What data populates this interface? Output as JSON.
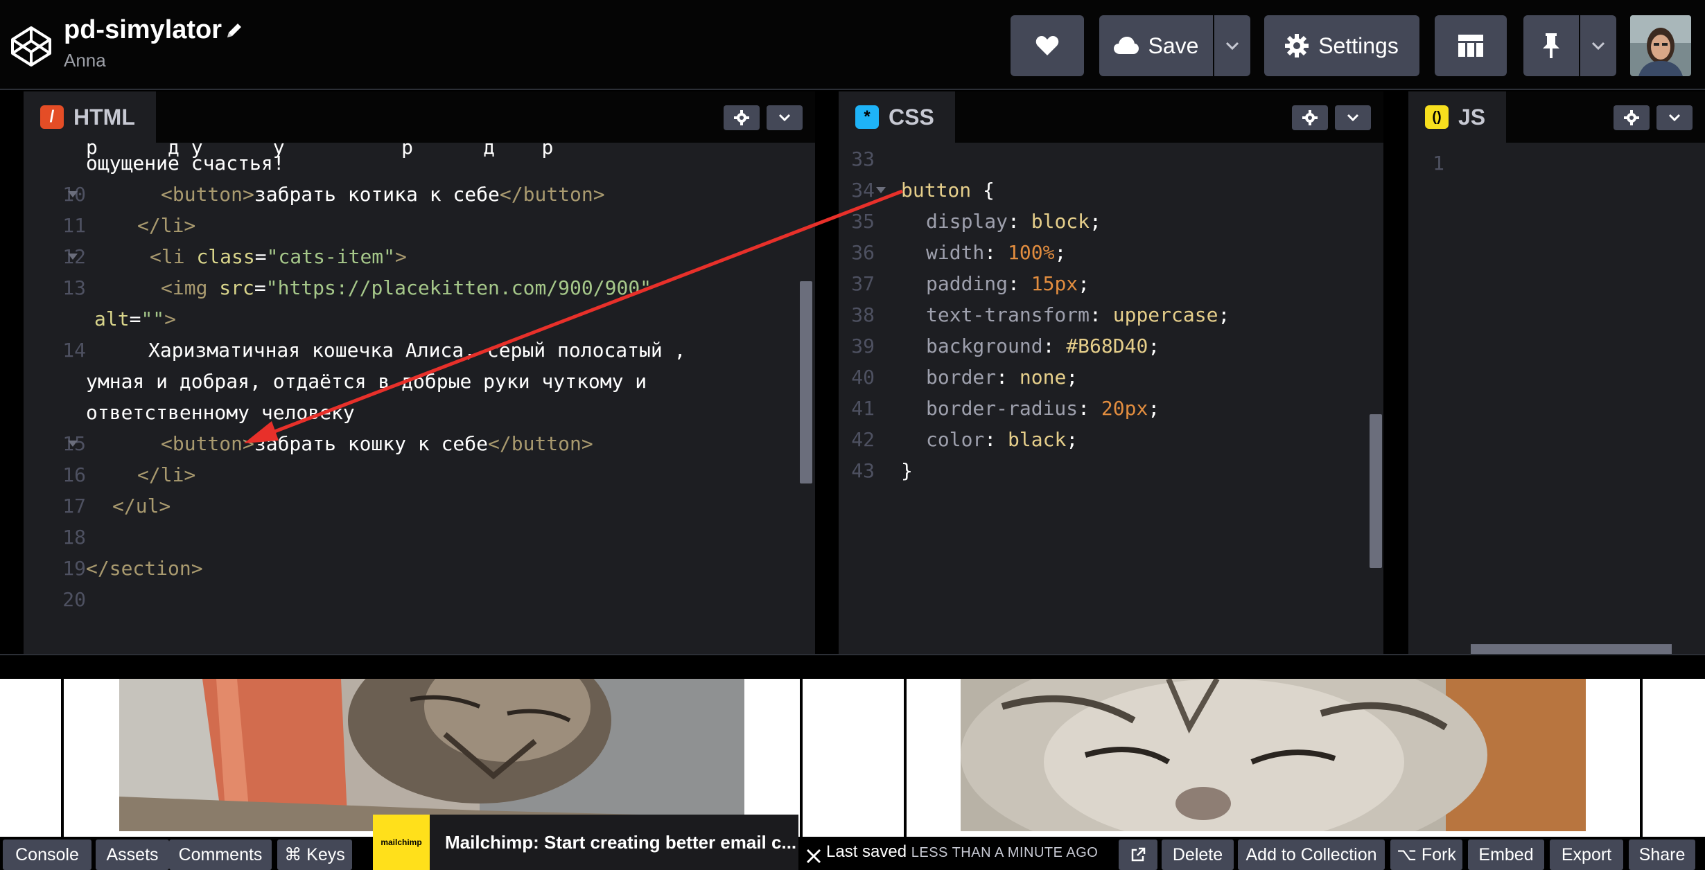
{
  "header": {
    "title": "pd-simylator",
    "author": "Anna",
    "save_label": "Save",
    "settings_label": "Settings"
  },
  "panels": {
    "html": {
      "label": "HTML",
      "lines": [
        {
          "num": "",
          "text": "ощущение счастья!"
        },
        {
          "num": "10",
          "text": "<button>забрать котика к себе</button>"
        },
        {
          "num": "11",
          "text": "</li>"
        },
        {
          "num": "12",
          "text": "<li class=\"cats-item\">"
        },
        {
          "num": "13",
          "text": "<img src=\"https://placekitten.com/900/900\""
        },
        {
          "num": "",
          "text": "alt=\"\">"
        },
        {
          "num": "14",
          "text": "Харизматичная кошечка Алиса, серый полосатый ,"
        },
        {
          "num": "",
          "text": "умная и добрая, отдаётся в добрые руки чуткому и"
        },
        {
          "num": "",
          "text": "ответственному человеку"
        },
        {
          "num": "15",
          "text": "<button>забрать кошку к себе</button>"
        },
        {
          "num": "16",
          "text": "</li>"
        },
        {
          "num": "17",
          "text": "</ul>"
        },
        {
          "num": "18",
          "text": ""
        },
        {
          "num": "19",
          "text": "</section>"
        },
        {
          "num": "20",
          "text": ""
        }
      ]
    },
    "css": {
      "label": "CSS",
      "lines": [
        {
          "num": "33",
          "text": ""
        },
        {
          "num": "34",
          "text": "button {"
        },
        {
          "num": "35",
          "text": "display: block;"
        },
        {
          "num": "36",
          "text": "width: 100%;"
        },
        {
          "num": "37",
          "text": "padding: 15px;"
        },
        {
          "num": "38",
          "text": "text-transform: uppercase;"
        },
        {
          "num": "39",
          "text": "background: #B68D40;"
        },
        {
          "num": "40",
          "text": "border: none;"
        },
        {
          "num": "41",
          "text": "border-radius: 20px;"
        },
        {
          "num": "42",
          "text": "color: black;"
        },
        {
          "num": "43",
          "text": "}"
        }
      ]
    },
    "js": {
      "label": "JS",
      "lines": [
        {
          "num": "1",
          "text": ""
        }
      ]
    }
  },
  "ad": {
    "logo_text": "mailchimp",
    "text": "Mailchimp: Start creating better email c..."
  },
  "status": {
    "saved_prefix": "Last saved",
    "saved_time": "LESS THAN A MINUTE AGO"
  },
  "footer": {
    "console": "Console",
    "assets": "Assets",
    "comments": "Comments",
    "keys": "⌘ Keys",
    "delete": "Delete",
    "add_to_collection": "Add to Collection",
    "fork": "⌥ Fork",
    "embed": "Embed",
    "export": "Export",
    "share": "Share"
  },
  "colors": {
    "accent_html": "#e44d26",
    "accent_css": "#1eb3f7",
    "accent_js": "#f7df1e",
    "arrow": "#e8302a",
    "button_bg": "#444857"
  }
}
